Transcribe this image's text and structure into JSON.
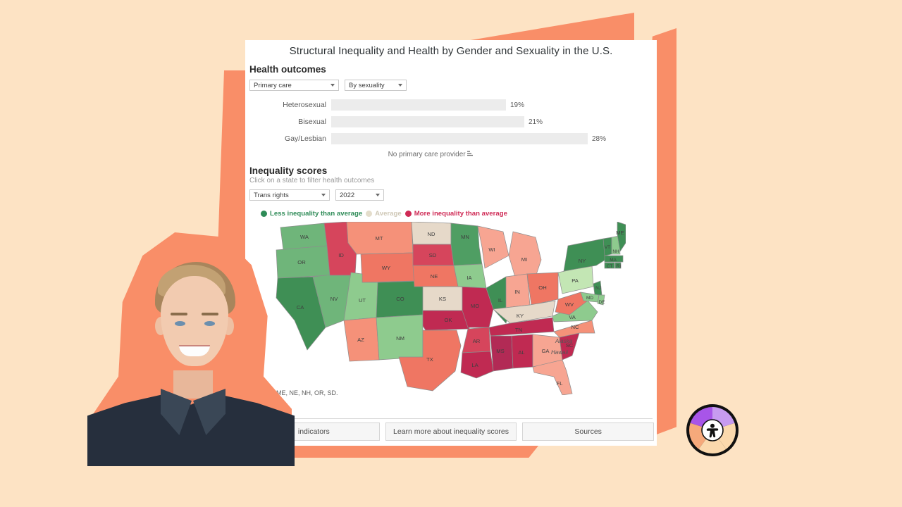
{
  "page": {
    "background_color": "#fde3c4",
    "accent_color": "#f98e68",
    "card_background": "#ffffff"
  },
  "viz": {
    "title": "Structural Inequality and Health by Gender and Sexuality in the U.S."
  },
  "health_outcomes": {
    "heading": "Health outcomes",
    "controls": [
      {
        "name": "outcome-select",
        "value": "Primary care"
      },
      {
        "name": "breakdown-select",
        "value": "By sexuality"
      }
    ],
    "axis_label": "No primary care provider",
    "sort_icon": "sort-icon"
  },
  "inequality": {
    "heading": "Inequality scores",
    "subheading": "Click on a state to filter health outcomes",
    "controls": [
      {
        "name": "topic-select",
        "value": "Trans rights"
      },
      {
        "name": "year-select",
        "value": "2022"
      }
    ],
    "legend": [
      {
        "label": "Less inequality than average",
        "color": "#2e8b57"
      },
      {
        "label": "Average",
        "color": "#e4ddcb"
      },
      {
        "label": "More inequality than average",
        "color": "#cf2a55"
      }
    ],
    "inset_labels": [
      "Alaska",
      "Hawaii"
    ],
    "map_note": "data: AL, ME, NE, NH, OR, SD."
  },
  "footer": {
    "buttons": [
      "indicators",
      "Learn more about inequality scores",
      "Sources"
    ]
  },
  "logo": {
    "name": "brand-wheel-logo",
    "segments": [
      "#a855e8",
      "#c79bf0",
      "#fbd9ad",
      "#f6a97b"
    ],
    "center_icon": "person-icon"
  },
  "chart_data": {
    "type": "bar",
    "title": "No primary care provider",
    "orientation": "horizontal",
    "categories": [
      "Heterosexual",
      "Bisexual",
      "Gay/Lesbian"
    ],
    "values": [
      19,
      21,
      28
    ],
    "value_labels": [
      "19%",
      "21%",
      "28%"
    ],
    "xlabel": "No primary care provider",
    "ylabel": "",
    "xlim": [
      0,
      32
    ],
    "grid": false,
    "bar_color": "#ececec"
  },
  "map_data": {
    "type": "choropleth",
    "title": "Inequality scores — Trans rights, 2022",
    "scale": {
      "less": "#4f9e63",
      "less_strong": "#3f8f55",
      "less_light": "#8ecb8e",
      "average": "#e6d9c9",
      "more_light": "#f59179",
      "more": "#ef7663",
      "more_strong": "#d6455c",
      "most": "#c02a52",
      "deepest": "#b22a55"
    },
    "states": [
      {
        "code": "WA",
        "color": "#6fb57a"
      },
      {
        "code": "OR",
        "color": "#6fb57a"
      },
      {
        "code": "CA",
        "color": "#3f8f55"
      },
      {
        "code": "NV",
        "color": "#6fb57a"
      },
      {
        "code": "ID",
        "color": "#d6455c"
      },
      {
        "code": "MT",
        "color": "#f59179"
      },
      {
        "code": "WY",
        "color": "#ef7663"
      },
      {
        "code": "UT",
        "color": "#8ecb8e"
      },
      {
        "code": "CO",
        "color": "#3f8f55"
      },
      {
        "code": "AZ",
        "color": "#f59179"
      },
      {
        "code": "NM",
        "color": "#8ecb8e"
      },
      {
        "code": "ND",
        "color": "#e6d9c9"
      },
      {
        "code": "SD",
        "color": "#d6455c"
      },
      {
        "code": "NE",
        "color": "#ef7663"
      },
      {
        "code": "KS",
        "color": "#e6d9c9"
      },
      {
        "code": "OK",
        "color": "#c02a52"
      },
      {
        "code": "TX",
        "color": "#ef7663"
      },
      {
        "code": "MN",
        "color": "#4f9e63"
      },
      {
        "code": "IA",
        "color": "#8ecb8e"
      },
      {
        "code": "MO",
        "color": "#c02a52"
      },
      {
        "code": "AR",
        "color": "#d6455c"
      },
      {
        "code": "LA",
        "color": "#c02a52"
      },
      {
        "code": "WI",
        "color": "#f7a592"
      },
      {
        "code": "IL",
        "color": "#3f8f55"
      },
      {
        "code": "MI",
        "color": "#f7a592"
      },
      {
        "code": "IN",
        "color": "#f7a592"
      },
      {
        "code": "OH",
        "color": "#ef7663"
      },
      {
        "code": "KY",
        "color": "#e6d9c9"
      },
      {
        "code": "TN",
        "color": "#c02a52"
      },
      {
        "code": "MS",
        "color": "#b22a55"
      },
      {
        "code": "AL",
        "color": "#c02a52"
      },
      {
        "code": "GA",
        "color": "#f7a592"
      },
      {
        "code": "FL",
        "color": "#f7a592"
      },
      {
        "code": "SC",
        "color": "#c02a52"
      },
      {
        "code": "NC",
        "color": "#f59179"
      },
      {
        "code": "VA",
        "color": "#8ecb8e"
      },
      {
        "code": "WV",
        "color": "#ef7663"
      },
      {
        "code": "PA",
        "color": "#c3e6b4"
      },
      {
        "code": "NY",
        "color": "#3f8f55"
      },
      {
        "code": "VT",
        "color": "#3f8f55"
      },
      {
        "code": "NH",
        "color": "#8ecb8e"
      },
      {
        "code": "ME",
        "color": "#3f8f55"
      },
      {
        "code": "MA",
        "color": "#3f8f55"
      },
      {
        "code": "CT",
        "color": "#3f8f55"
      },
      {
        "code": "RI",
        "color": "#3f8f55"
      },
      {
        "code": "NJ",
        "color": "#3f8f55"
      },
      {
        "code": "DE",
        "color": "#8ecb8e"
      },
      {
        "code": "MD",
        "color": "#8ecb8e"
      }
    ]
  }
}
